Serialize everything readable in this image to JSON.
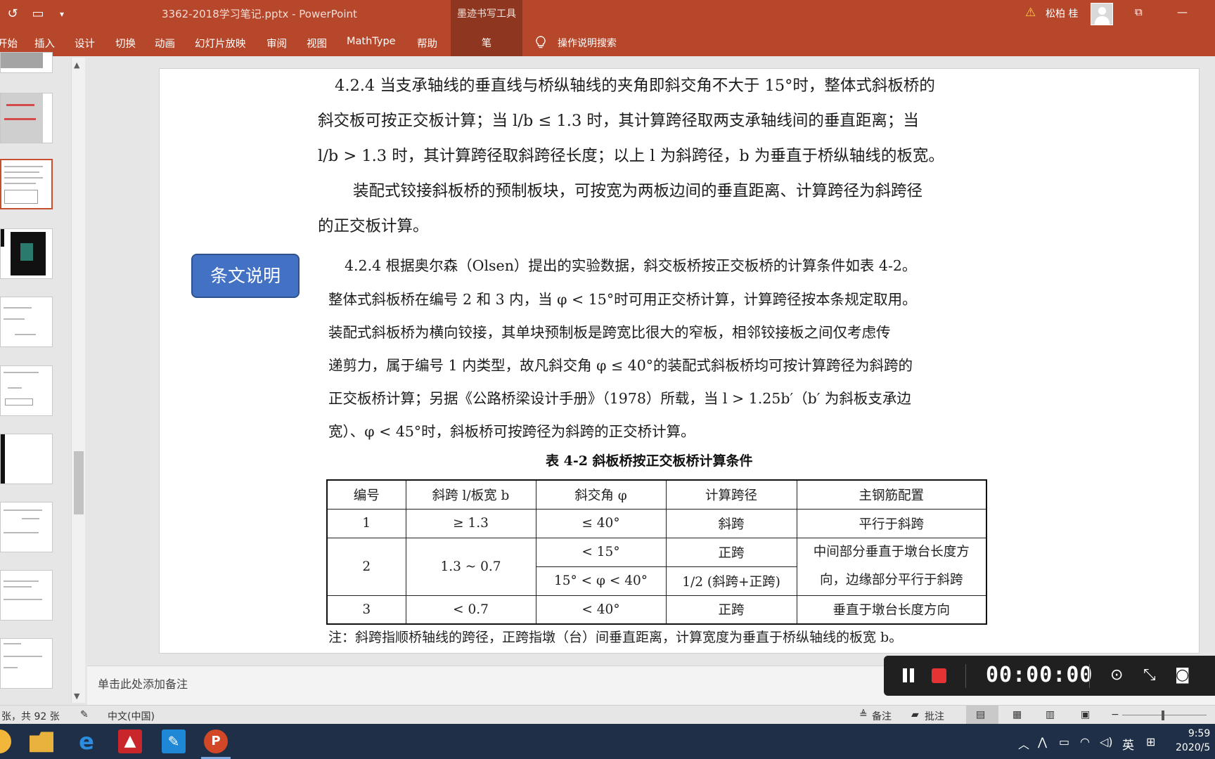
{
  "app": {
    "document_title": "3362-2018学习笔记.pptx - PowerPoint",
    "context_group": "墨迹书写工具",
    "context_tab": "笔",
    "user_name": "松柏 桂"
  },
  "ribbon": {
    "tabs": [
      "开始",
      "插入",
      "设计",
      "切换",
      "动画",
      "幻灯片放映",
      "审阅",
      "视图",
      "MathType",
      "帮助"
    ],
    "tell_me": "操作说明搜索"
  },
  "slide": {
    "para1": [
      "4.2.4 当支承轴线的垂直线与桥纵轴线的夹角即斜交角不大于 15°时，整体式斜板桥的",
      "斜交板可按正交板计算；当 l/b ≤ 1.3 时，其计算跨径取两支承轴线间的垂直距离；当",
      "l/b > 1.3 时，其计算跨径取斜跨径长度；以上 l 为斜跨径，b 为垂直于桥纵轴线的板宽。",
      "装配式铰接斜板桥的预制板块，可按宽为两板边间的垂直距离、计算跨径为斜跨径",
      "的正交板计算。"
    ],
    "callout": "条文说明",
    "para2": [
      "4.2.4 根据奥尔森（Olsen）提出的实验数据，斜交板桥按正交板桥的计算条件如表 4-2。",
      "整体式斜板桥在编号 2 和 3 内，当 φ < 15°时可用正交桥计算，计算跨径按本条规定取用。",
      "装配式斜板桥为横向铰接，其单块预制板是跨宽比很大的窄板，相邻铰接板之间仅考虑传",
      "递剪力，属于编号 1 内类型，故凡斜交角 φ ≤ 40°的装配式斜板桥均可按计算跨径为斜跨的",
      "正交板桥计算；另据《公路桥梁设计手册》（1978）所载，当 l > 1.25b′（b′ 为斜板支承边",
      "宽）、φ < 45°时，斜板桥可按跨径为斜跨的正交桥计算。"
    ],
    "table_title": "表 4-2 斜板桥按正交板桥计算条件",
    "table_headers": [
      "编号",
      "斜跨 l/板宽 b",
      "斜交角 φ",
      "计算跨径",
      "主钢筋配置"
    ],
    "table_rows": [
      {
        "no": "1",
        "ratio": "≥ 1.3",
        "angle": "≤ 40°",
        "span": "斜跨",
        "rebar": "平行于斜跨"
      },
      {
        "no": "2",
        "ratio": "1.3 ~ 0.7",
        "angle": "< 15°",
        "span": "正跨",
        "rebar": "中间部分垂直于墩台长度方向，边缘部分平行于斜跨",
        "angle2": "15° < φ < 40°",
        "span2": "1/2 (斜跨+正跨)"
      },
      {
        "no": "3",
        "ratio": "< 0.7",
        "angle": "< 40°",
        "span": "正跨",
        "rebar": "垂直于墩台长度方向"
      }
    ],
    "note": "注：斜跨指顺桥轴线的跨径，正跨指墩（台）间垂直距离，计算宽度为垂直于桥纵轴线的板宽 b。"
  },
  "notes_placeholder": "单击此处添加备注",
  "recorder": {
    "time": "00:00:00"
  },
  "status": {
    "slide_count": "张，共 92 张",
    "language": "中文(中国)",
    "notes_btn": "备注",
    "comments_btn": "批注"
  },
  "taskbar": {
    "ime": "英",
    "time": "9:59",
    "date": "2020/5"
  }
}
